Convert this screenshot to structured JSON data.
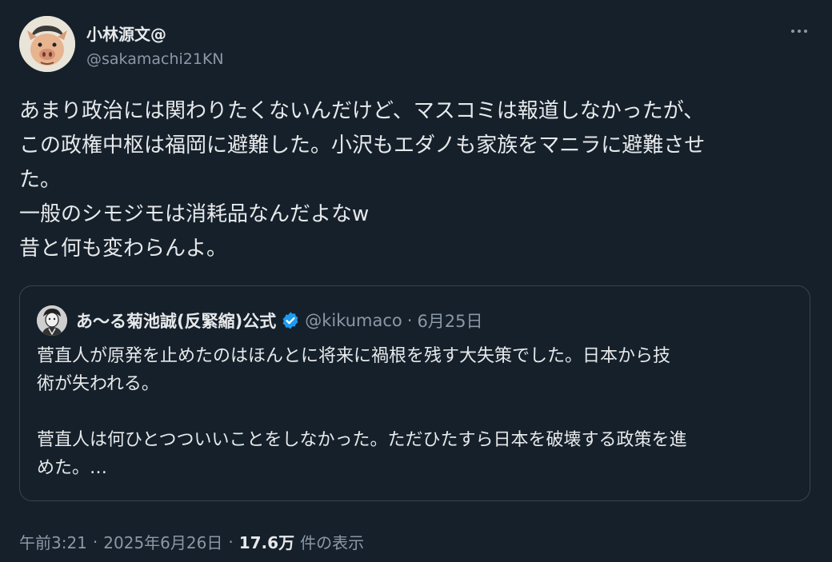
{
  "author": {
    "display_name": "小林源文@",
    "handle": "@sakamachi21KN",
    "avatar_icon": "pig-face-avatar-icon"
  },
  "more_icon": "more-options-icon",
  "tweet": {
    "lines": [
      "あまり政治には関わりたくないんだけど、マスコミは報道しなかったが、",
      "この政権中枢は福岡に避難した。小沢もエダノも家族をマニラに避難させ",
      "た。",
      "一般のシモジモは消耗品なんだよなw",
      "昔と何も変わらんよ。"
    ]
  },
  "quoted": {
    "display_name": "あ〜る菊池誠(反緊縮)公式",
    "verified_icon": "verified-badge-icon",
    "handle": "@kikumaco",
    "separator": "·",
    "date": "6月25日",
    "text_lines_1": [
      "菅直人が原発を止めたのはほんとに将来に禍根を残す大失策でした。日本から技",
      "術が失われる。"
    ],
    "text_lines_2": [
      "菅直人は何ひとつついいことをしなかった。ただひたすら日本を破壊する政策を進",
      "めた。…"
    ]
  },
  "meta": {
    "time": "午前3:21",
    "separator": "·",
    "date": "2025年6月26日",
    "views_count": "17.6万",
    "views_label": "件の表示"
  },
  "colors": {
    "background": "#15202b",
    "text": "#e7e9ea",
    "secondary": "#8b98a5",
    "border": "#38444d",
    "verified": "#1d9bf0"
  }
}
